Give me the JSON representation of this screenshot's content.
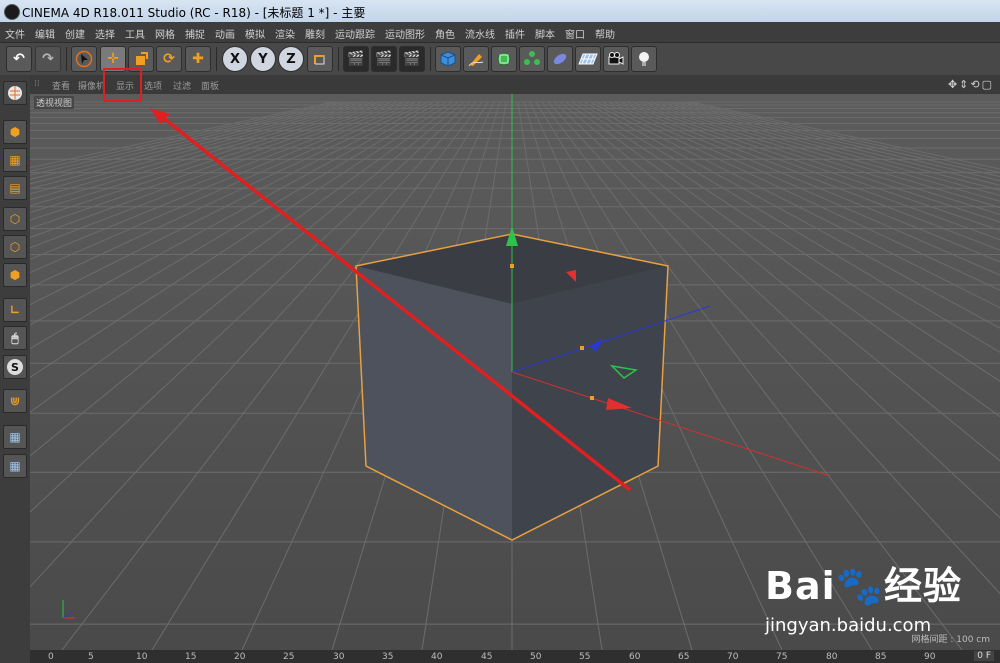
{
  "window": {
    "title": "CINEMA 4D R18.011 Studio (RC - R18) - [未标题 1 *] - 主要"
  },
  "menu": [
    "文件",
    "编辑",
    "创建",
    "选择",
    "工具",
    "网格",
    "捕捉",
    "动画",
    "模拟",
    "渲染",
    "雕刻",
    "运动跟踪",
    "运动图形",
    "角色",
    "流水线",
    "插件",
    "脚本",
    "窗口",
    "帮助"
  ],
  "toolbar": {
    "undo": "↶",
    "redo": "↷",
    "x": "X",
    "y": "Y",
    "z": "Z"
  },
  "viewport": {
    "menu": [
      "查看",
      "摄像机",
      "显示",
      "选项",
      "过滤",
      "面板"
    ],
    "label": "透视视图",
    "grid_spacing": "网格间距 : 100 cm",
    "nav": "✥⇕⟲▢"
  },
  "timeline": {
    "ticks": [
      "0",
      "5",
      "10",
      "15",
      "20",
      "25",
      "30",
      "35",
      "40",
      "45",
      "50",
      "55",
      "60",
      "65",
      "70",
      "75",
      "80",
      "85",
      "90"
    ],
    "frame": "0 F"
  },
  "watermark": {
    "logo": "Bai🐾经验",
    "url": "jingyan.baidu.com"
  },
  "colors": {
    "accent": "#f0a020",
    "highlight": "#e02020",
    "x_axis": "#e03030",
    "y_axis": "#2ec24a",
    "z_axis": "#2a3ad0"
  }
}
